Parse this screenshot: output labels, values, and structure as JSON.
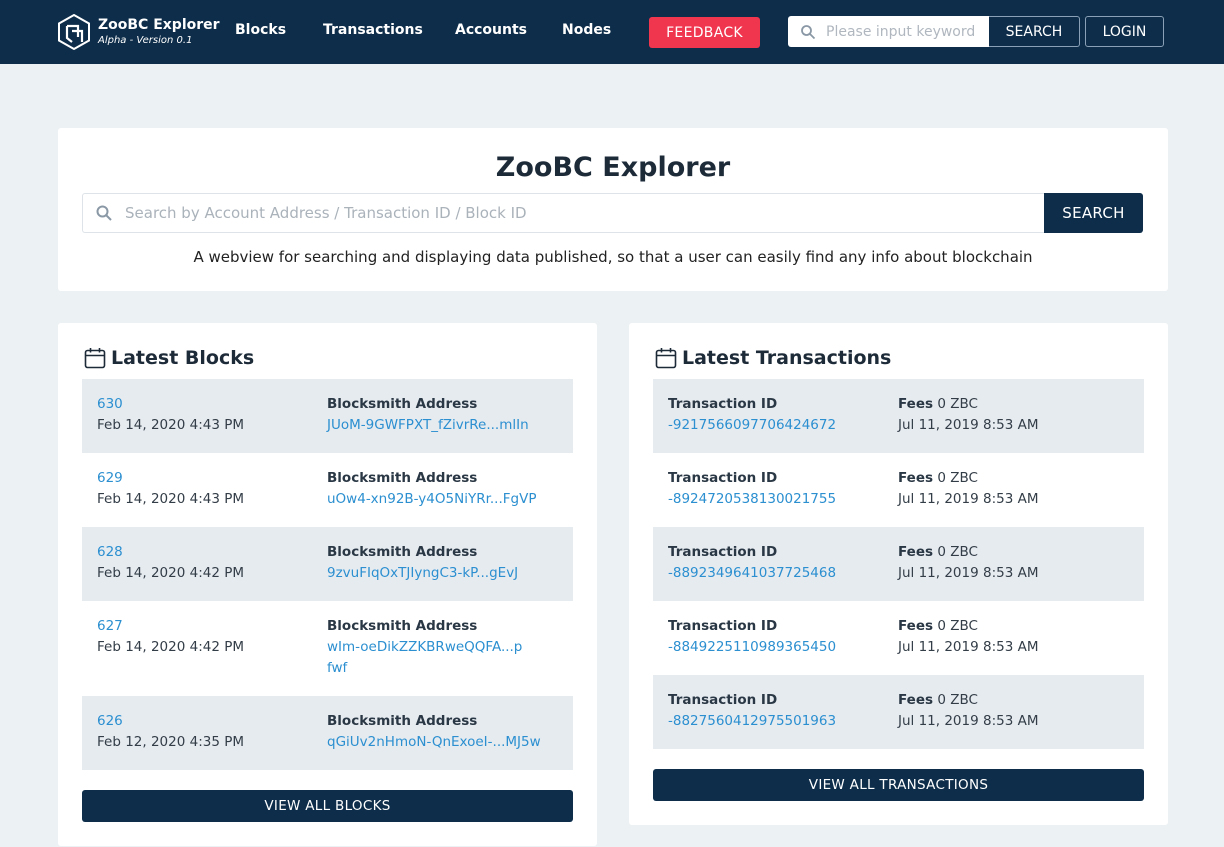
{
  "header": {
    "brand_title": "ZooBC Explorer",
    "brand_subtitle": "Alpha - Version 0.1",
    "nav": [
      "Blocks",
      "Transactions",
      "Accounts",
      "Nodes"
    ],
    "feedback_label": "FEEDBACK",
    "search_placeholder": "Please input keyword",
    "search_label": "SEARCH",
    "login_label": "LOGIN"
  },
  "hero": {
    "title": "ZooBC Explorer",
    "search_placeholder": "Search by Account Address / Transaction ID / Block ID",
    "search_label": "SEARCH",
    "description": "A webview for searching and displaying data published, so that a user can easily find any info about blockchain"
  },
  "blocks": {
    "title": "Latest Blocks",
    "address_label": "Blocksmith Address",
    "items": [
      {
        "height": "630",
        "time": "Feb 14, 2020 4:43 PM",
        "address": "JUoM-9GWFPXT_fZivrRe...mlIn"
      },
      {
        "height": "629",
        "time": "Feb 14, 2020 4:43 PM",
        "address": "uOw4-xn92B-y4O5NiYRr...FgVP"
      },
      {
        "height": "628",
        "time": "Feb 14, 2020 4:42 PM",
        "address": "9zvuFIqOxTJIyngC3-kP...gEvJ"
      },
      {
        "height": "627",
        "time": "Feb 14, 2020 4:42 PM",
        "address": "wIm-oeDikZZKBRweQQFA...pfwf"
      },
      {
        "height": "626",
        "time": "Feb 12, 2020 4:35 PM",
        "address": "qGiUv2nHmoN-QnExoeI-...MJ5w"
      }
    ],
    "view_all_label": "VIEW ALL BLOCKS"
  },
  "transactions": {
    "title": "Latest Transactions",
    "id_label": "Transaction ID",
    "fees_label": "Fees",
    "items": [
      {
        "id": "-9217566097706424672",
        "fees": "0 ZBC",
        "time": "Jul 11, 2019 8:53 AM"
      },
      {
        "id": "-8924720538130021755",
        "fees": "0 ZBC",
        "time": "Jul 11, 2019 8:53 AM"
      },
      {
        "id": "-8892349641037725468",
        "fees": "0 ZBC",
        "time": "Jul 11, 2019 8:53 AM"
      },
      {
        "id": "-8849225110989365450",
        "fees": "0 ZBC",
        "time": "Jul 11, 2019 8:53 AM"
      },
      {
        "id": "-8827560412975501963",
        "fees": "0 ZBC",
        "time": "Jul 11, 2019 8:53 AM"
      }
    ],
    "view_all_label": "VIEW ALL TRANSACTIONS"
  },
  "colors": {
    "navbar": "#0d2d4a",
    "feedback": "#f0364f",
    "link": "#2b8fd0",
    "row_alt": "#e6ebf0",
    "page_bg": "#ecf1f4"
  },
  "icons": [
    "zoobc-logo-icon",
    "search-icon",
    "calendar-icon"
  ]
}
